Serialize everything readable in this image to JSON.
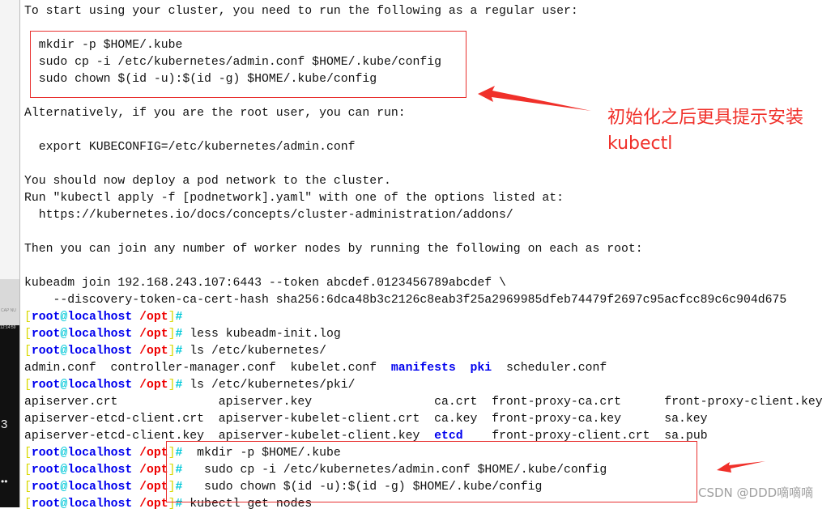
{
  "colors": {
    "annotation": "#f0302a",
    "prompt_user": "#0000ee",
    "prompt_path": "#ee0000",
    "prompt_symbol": "#00c8d8",
    "prompt_bracket": "#d8d800",
    "directory": "#0000ee"
  },
  "taskbar": {
    "cap": "CAP NU",
    "clock": "12:14:59",
    "number": "3",
    "dots": "••"
  },
  "prompt": {
    "open": "[",
    "user": "root",
    "at": "@",
    "host": "localhost",
    "path": " /opt",
    "close": "]",
    "hash": "#"
  },
  "lines": [
    [
      {
        "t": "To start using your cluster, you need to run the following as a regular user:"
      }
    ],
    [],
    [
      {
        "t": "  mkdir -p $HOME/.kube"
      }
    ],
    [
      {
        "t": "  sudo cp -i /etc/kubernetes/admin.conf $HOME/.kube/config"
      }
    ],
    [
      {
        "t": "  sudo chown $(id -u):$(id -g) $HOME/.kube/config"
      }
    ],
    [],
    [
      {
        "t": "Alternatively, if you are the root user, you can run:"
      }
    ],
    [],
    [
      {
        "t": "  export KUBECONFIG=/etc/kubernetes/admin.conf"
      }
    ],
    [],
    [
      {
        "t": "You should now deploy a pod network to the cluster."
      }
    ],
    [
      {
        "t": "Run \"kubectl apply -f [podnetwork].yaml\" with one of the options listed at:"
      }
    ],
    [
      {
        "t": "  https://kubernetes.io/docs/concepts/cluster-administration/addons/"
      }
    ],
    [],
    [
      {
        "t": "Then you can join any number of worker nodes by running the following on each as root:"
      }
    ],
    [],
    [
      {
        "t": "kubeadm join 192.168.243.107:6443 --token abcdef.0123456789abcdef \\"
      }
    ],
    [
      {
        "t": "    --discovery-token-ca-cert-hash sha256:6dca48b3c2126c8eab3f25a2969985dfeb74479f2697c95acfcc89c6c904d675"
      }
    ],
    [
      {
        "p": true
      }
    ],
    [
      {
        "p": true
      },
      {
        "t": " less kubeadm-init.log"
      }
    ],
    [
      {
        "p": true
      },
      {
        "t": " ls /etc/kubernetes/"
      }
    ],
    [
      {
        "t": "admin.conf  controller-manager.conf  kubelet.conf  "
      },
      {
        "t": "manifests",
        "d": true
      },
      {
        "t": "  "
      },
      {
        "t": "pki",
        "d": true
      },
      {
        "t": "  scheduler.conf"
      }
    ],
    [
      {
        "p": true
      },
      {
        "t": " ls /etc/kubernetes/pki/"
      }
    ],
    [
      {
        "t": "apiserver.crt              apiserver.key                 ca.crt  front-proxy-ca.crt      front-proxy-client.key"
      }
    ],
    [
      {
        "t": "apiserver-etcd-client.crt  apiserver-kubelet-client.crt  ca.key  front-proxy-ca.key      sa.key"
      }
    ],
    [
      {
        "t": "apiserver-etcd-client.key  apiserver-kubelet-client.key  "
      },
      {
        "t": "etcd",
        "d": true
      },
      {
        "t": "    front-proxy-client.crt  sa.pub"
      }
    ],
    [
      {
        "p": true
      },
      {
        "t": "  mkdir -p $HOME/.kube"
      }
    ],
    [
      {
        "p": true
      },
      {
        "t": "   sudo cp -i /etc/kubernetes/admin.conf $HOME/.kube/config"
      }
    ],
    [
      {
        "p": true
      },
      {
        "t": "   sudo chown $(id -u):$(id -g) $HOME/.kube/config"
      }
    ],
    [
      {
        "p": true
      },
      {
        "t": " kubectl get nodes"
      }
    ]
  ],
  "annotation": {
    "line1": "初始化之后更具提示安装",
    "line2": "kubectl"
  },
  "watermark": "CSDN @DDD嘀嘀嘀"
}
